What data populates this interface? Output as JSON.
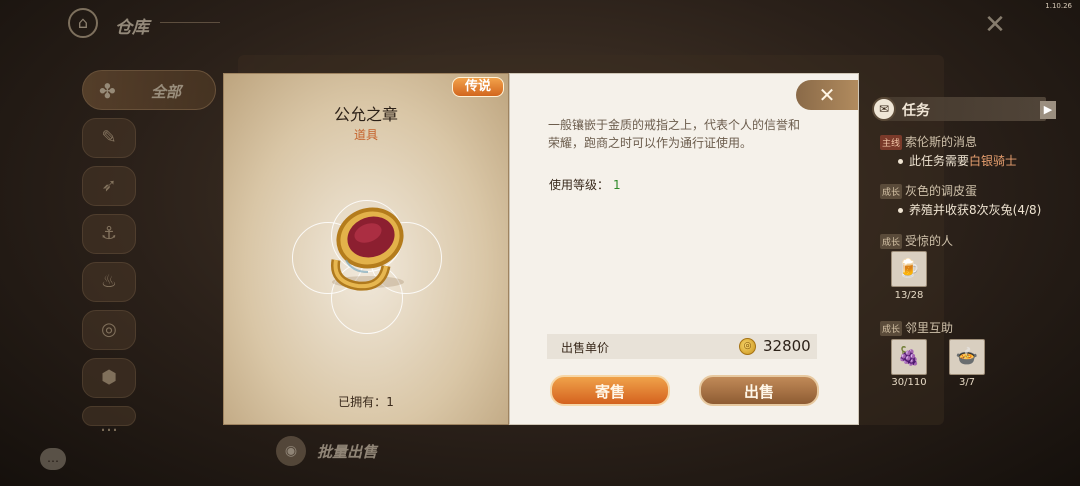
{
  "header": {
    "title": "仓库",
    "version": "1.10.26"
  },
  "sidebar": {
    "all_label": "全部"
  },
  "bulk_sell": {
    "label": "批量出售"
  },
  "quest_panel": {
    "title": "任务",
    "quests": [
      {
        "tag": "主线",
        "name": "索伦斯的消息",
        "desc_prefix": "此任务需要",
        "desc_highlight": "白银骑士"
      },
      {
        "tag": "成长",
        "name": "灰色的调皮蛋",
        "desc": "养殖并收获8次灰兔(4/8)"
      },
      {
        "tag": "成长",
        "name": "受惊的人",
        "item_count": "13/28"
      },
      {
        "tag": "成长",
        "name": "邻里互助",
        "item_counts": [
          "30/110",
          "3/7"
        ]
      }
    ]
  },
  "item": {
    "rarity": "传说",
    "name": "公允之章",
    "type": "道具",
    "owned_label": "已拥有：",
    "owned_count": "1",
    "description": "一般镶嵌于金质的戒指之上，代表个人的信誉和荣耀，跑商之时可以作为通行证使用。",
    "level_label": "使用等级：",
    "level_value": "1",
    "price_label": "出售单价",
    "price_value": "32800",
    "consign_label": "寄售",
    "sell_label": "出售"
  },
  "colors": {
    "rarity_badge": "#d2661e",
    "item_type": "#c5622c",
    "level_value": "#2f8a2a",
    "consign_button": "#e07d30",
    "sell_button": "#a8744a"
  },
  "icons": {
    "home": "home-icon",
    "close": "close-icon",
    "coin": "coin-icon",
    "chat": "chat-icon",
    "ring": "ring-icon"
  }
}
